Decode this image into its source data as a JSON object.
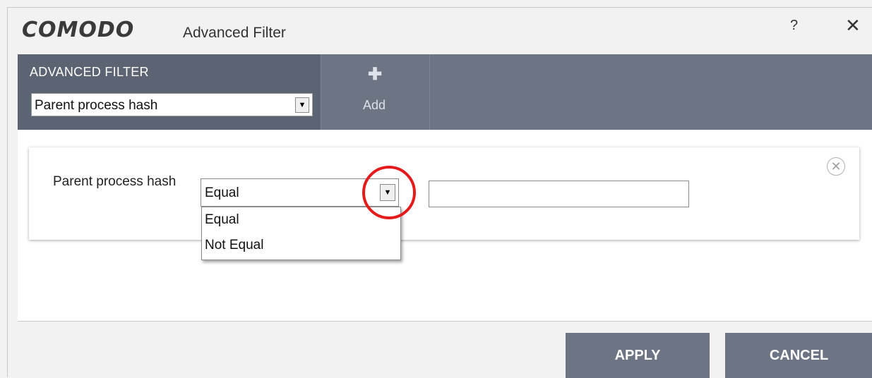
{
  "window": {
    "brand": "COMODO",
    "title": "Advanced Filter",
    "help_label": "?",
    "close_label": "✕"
  },
  "toolbar": {
    "filter_label": "ADVANCED FILTER",
    "filter_select_value": "Parent process hash",
    "add_label": "Add",
    "add_icon": "plus-icon"
  },
  "condition": {
    "field_label": "Parent process hash",
    "operator_value": "Equal",
    "operator_options": [
      "Equal",
      "Not Equal"
    ],
    "value_input": "",
    "remove_icon": "circle-x-icon",
    "highlight_color": "#e41b1b"
  },
  "buttons": {
    "apply": "APPLY",
    "cancel": "CANCEL"
  },
  "colors": {
    "toolbar_bg": "#6d7585",
    "toolbar_filter_bg": "#5c6473"
  }
}
